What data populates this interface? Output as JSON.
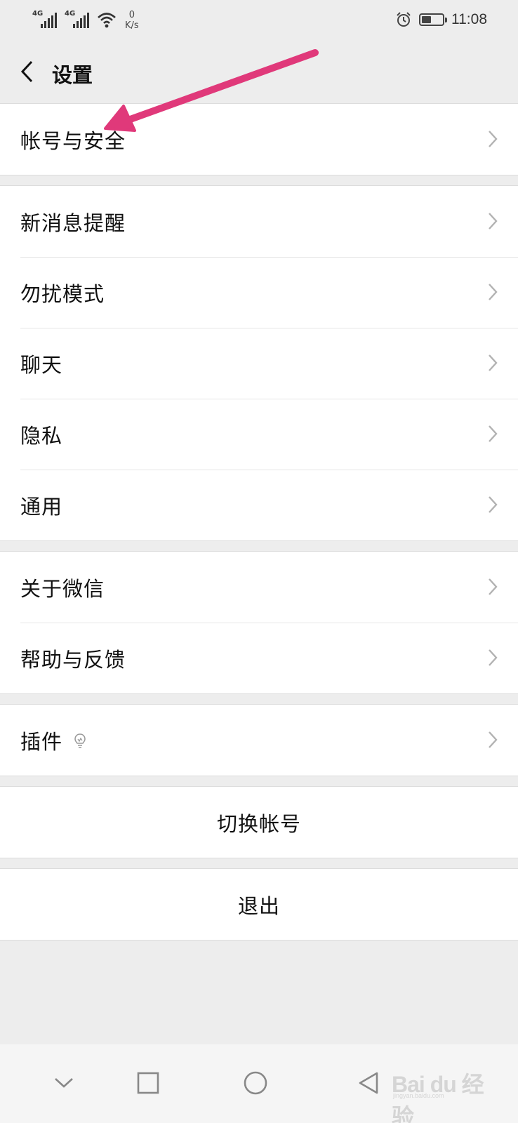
{
  "status_bar": {
    "sim1_label": "4G",
    "sim2_label": "4G",
    "speed_value": "0",
    "speed_unit": "K/s",
    "time": "11:08",
    "battery_level": 0.45
  },
  "header": {
    "title": "设置"
  },
  "groups": {
    "account": {
      "label": "帐号与安全"
    },
    "settings": {
      "items": [
        {
          "label": "新消息提醒"
        },
        {
          "label": "勿扰模式"
        },
        {
          "label": "聊天"
        },
        {
          "label": "隐私"
        },
        {
          "label": "通用"
        }
      ]
    },
    "about": {
      "items": [
        {
          "label": "关于微信"
        },
        {
          "label": "帮助与反馈"
        }
      ]
    },
    "plugins": {
      "label": "插件"
    },
    "switch_account": {
      "label": "切换帐号"
    },
    "logout": {
      "label": "退出"
    }
  },
  "watermark": {
    "text": "Bai du 经验",
    "sub": "jingyan.baidu.com"
  },
  "colors": {
    "background": "#ededed",
    "annotation_arrow": "#e0397a"
  }
}
